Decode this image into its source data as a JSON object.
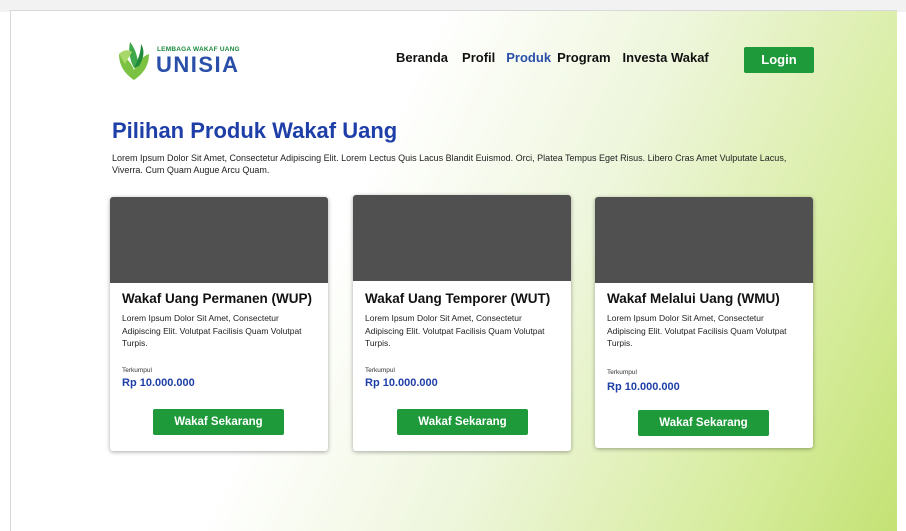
{
  "logo": {
    "small_text": "LEMBAGA WAKAF UANG",
    "big_text": "UNISIA",
    "icon": "leaf-logo-icon"
  },
  "nav": {
    "items": [
      "Beranda",
      "Profil",
      "Produk",
      "Program",
      "Investa Wakaf"
    ],
    "active": "Produk",
    "login": "Login"
  },
  "main": {
    "title": "Pilihan Produk Wakaf Uang",
    "intro": "Lorem Ipsum Dolor Sit Amet, Consectetur Adipiscing Elit. Lorem Lectus Quis Lacus Blandit Euismod. Orci, Platea Tempus Eget Risus. Libero Cras Amet Vulputate Lacus, Viverra. Cum Quam Augue Arcu Quam."
  },
  "cards": [
    {
      "title": "Wakaf Uang Permanen (WUP)",
      "desc": "Lorem Ipsum Dolor Sit Amet, Consectetur Adipiscing Elit. Volutpat Facilisis Quam Volutpat Turpis.",
      "collected_label": "Terkumpul",
      "amount": "Rp 10.000.000",
      "button": "Wakaf Sekarang"
    },
    {
      "title": "Wakaf Uang Temporer (WUT)",
      "desc": "Lorem Ipsum Dolor Sit Amet, Consectetur Adipiscing Elit. Volutpat Facilisis Quam Volutpat Turpis.",
      "collected_label": "Terkumpul",
      "amount": "Rp 10.000.000",
      "button": "Wakaf Sekarang"
    },
    {
      "title": "Wakaf Melalui Uang (WMU)",
      "desc": "Lorem Ipsum Dolor Sit Amet, Consectetur Adipiscing Elit. Volutpat Facilisis Quam Volutpat Turpis.",
      "collected_label": "Terkumpul",
      "amount": "Rp 10.000.000",
      "button": "Wakaf Sekarang"
    }
  ],
  "colors": {
    "brand_green": "#1e9a3b",
    "brand_blue": "#1f3fa8",
    "card_image": "#505050"
  }
}
